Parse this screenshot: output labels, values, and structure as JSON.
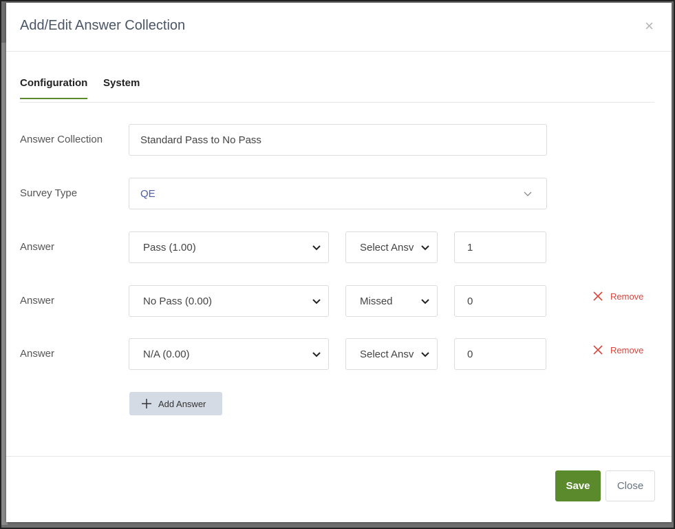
{
  "dialog": {
    "title": "Add/Edit Answer Collection",
    "close_glyph": "×"
  },
  "tabs": [
    {
      "label": "Configuration",
      "active": true
    },
    {
      "label": "System",
      "active": false
    }
  ],
  "form": {
    "answer_collection_label": "Answer Collection",
    "answer_collection_value": "Standard Pass to No Pass",
    "survey_type_label": "Survey Type",
    "survey_type_value": "QE",
    "answer_label": "Answer",
    "answers": [
      {
        "answer": "Pass (1.00)",
        "type": "Select Ansv",
        "value": "1",
        "removable": false
      },
      {
        "answer": "No Pass (0.00)",
        "type": "Missed",
        "value": "0",
        "removable": true
      },
      {
        "answer": "N/A (0.00)",
        "type": "Select Ansv",
        "value": "0",
        "removable": true
      }
    ],
    "remove_label": "Remove",
    "add_answer_label": "Add Answer"
  },
  "footer": {
    "save_label": "Save",
    "close_label": "Close"
  },
  "colors": {
    "accent_green": "#5a8a2c",
    "remove_red": "#d9443b",
    "add_button_bg": "#d4dbe5",
    "survey_value_color": "#4e5ba6"
  },
  "icons": {
    "close": "close-icon",
    "chevron": "chevron-down-icon",
    "remove": "remove-x-icon",
    "add": "plus-icon"
  }
}
